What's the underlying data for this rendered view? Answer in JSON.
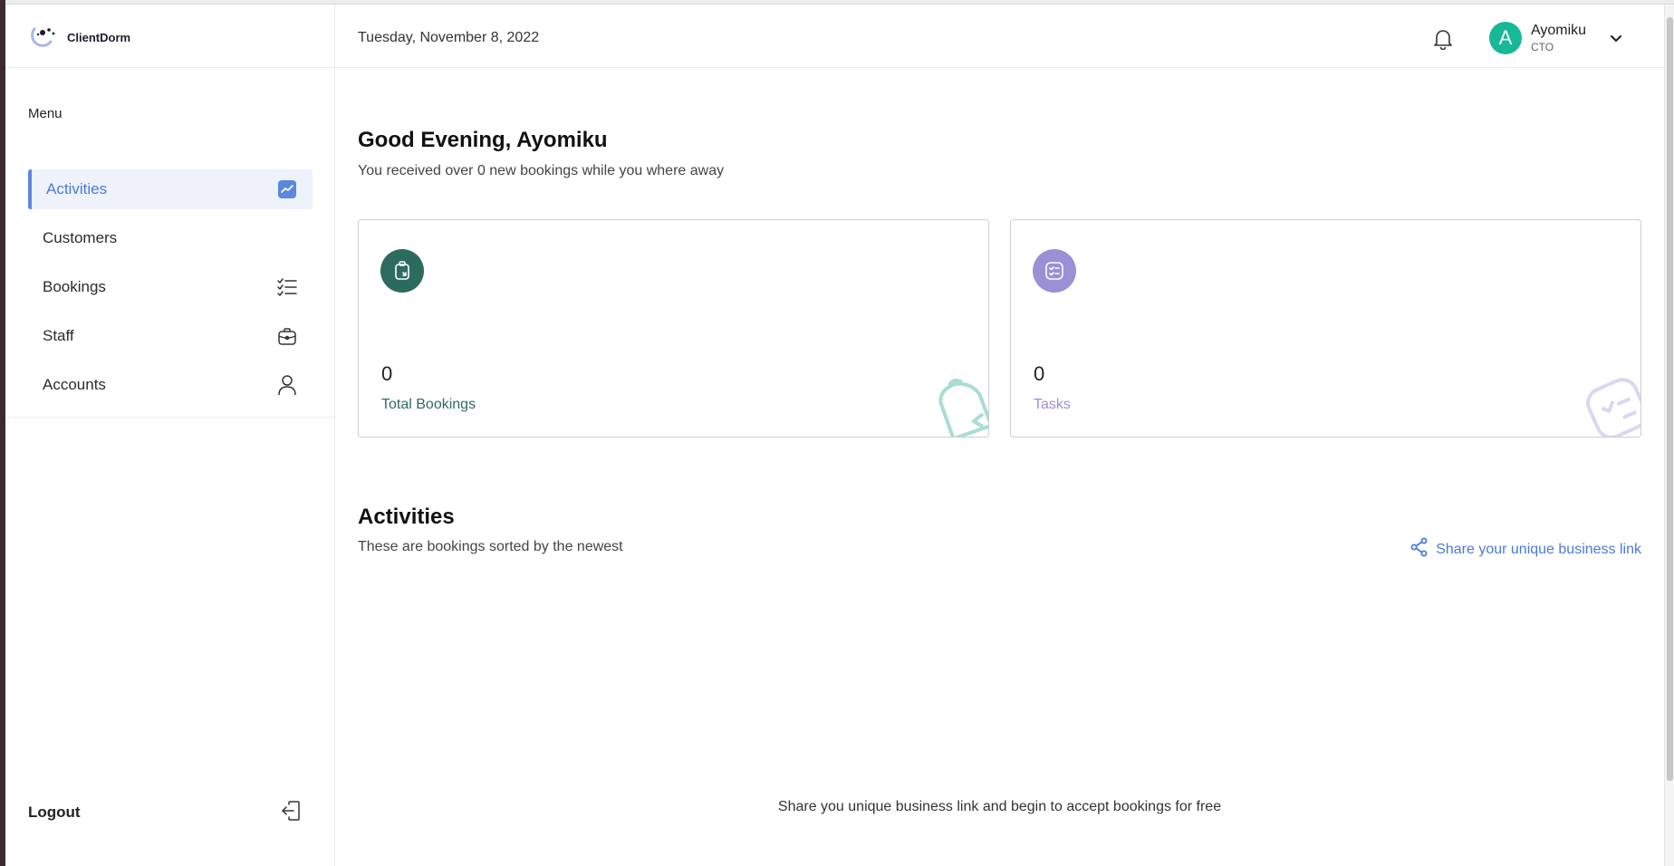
{
  "brand": {
    "name": "ClientDorm"
  },
  "sidebar": {
    "menu_label": "Menu",
    "items": [
      {
        "label": "Activities",
        "icon": "trend-chart-icon",
        "active": true
      },
      {
        "label": "Customers",
        "icon": "",
        "active": false
      },
      {
        "label": "Bookings",
        "icon": "checklist-icon",
        "active": false
      },
      {
        "label": "Staff",
        "icon": "briefcase-icon",
        "active": false
      },
      {
        "label": "Accounts",
        "icon": "user-icon",
        "active": false
      }
    ],
    "logout_label": "Logout"
  },
  "header": {
    "date": "Tuesday, November 8, 2022",
    "user": {
      "initial": "A",
      "name": "Ayomiku",
      "role": "CTO"
    }
  },
  "main": {
    "greeting": "Good Evening, Ayomiku",
    "subtitle": "You received over 0 new bookings while you where away",
    "cards": [
      {
        "value": "0",
        "label": "Total Bookings",
        "color": "#2e6b5f",
        "icon": "clipboard-icon"
      },
      {
        "value": "0",
        "label": "Tasks",
        "color": "#9b8fd6",
        "icon": "task-list-icon"
      }
    ],
    "activities": {
      "title": "Activities",
      "subtitle": "These are bookings sorted by the newest",
      "share_label": "Share your unique business link",
      "empty_message": "Share you unique business link and begin to accept bookings for free"
    }
  },
  "colors": {
    "accent": "#4a7ad8",
    "avatar": "#17b895",
    "bookings": "#2e6b5f",
    "tasks": "#9b8fd6"
  }
}
